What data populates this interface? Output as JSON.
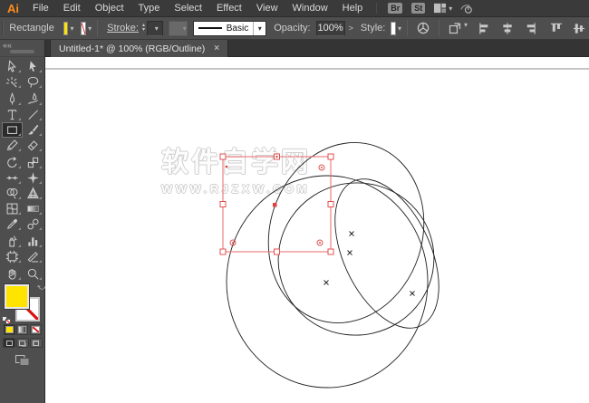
{
  "colors": {
    "fill_yellow": "#ffe400",
    "selection_red": "#e05050",
    "outline_black": "#1f1f1f",
    "artboard_line": "#8c8c8c",
    "ui_dark": "#3a3a3a",
    "ui_mid": "#4e4e4e"
  },
  "menu_bar": {
    "logo": "Ai",
    "items": [
      "File",
      "Edit",
      "Object",
      "Type",
      "Select",
      "Effect",
      "View",
      "Window",
      "Help"
    ],
    "brushes_badge": "Br",
    "styles_badge": "St"
  },
  "control_bar": {
    "context_label": "Rectangle",
    "stroke_label": "Stroke:",
    "stroke_weight_value": "",
    "brush_name": "Basic",
    "opacity_label": "Opacity:",
    "opacity_value": "100%",
    "opacity_more": ">",
    "style_label": "Style:"
  },
  "tab_bar": {
    "active_tab": "Untitled-1* @ 100% (RGB/Outline)",
    "close_glyph": "×",
    "collapse_glyph": "««"
  },
  "tools": {
    "active_tool": "rectangle",
    "list": [
      "selection",
      "direct-selection",
      "magic-wand",
      "lasso",
      "pen",
      "curvature",
      "type",
      "line-segment",
      "rectangle",
      "paintbrush",
      "pencil",
      "eraser",
      "rotate",
      "scale",
      "width",
      "free-transform",
      "shape-builder",
      "perspective-grid",
      "mesh",
      "gradient",
      "eyedropper",
      "blend",
      "symbol-sprayer",
      "column-graph",
      "artboard",
      "slice",
      "hand",
      "zoom"
    ]
  },
  "canvas": {
    "watermark_line1": "软件自学网",
    "watermark_line2": "WWW.RJZXW.COM"
  }
}
